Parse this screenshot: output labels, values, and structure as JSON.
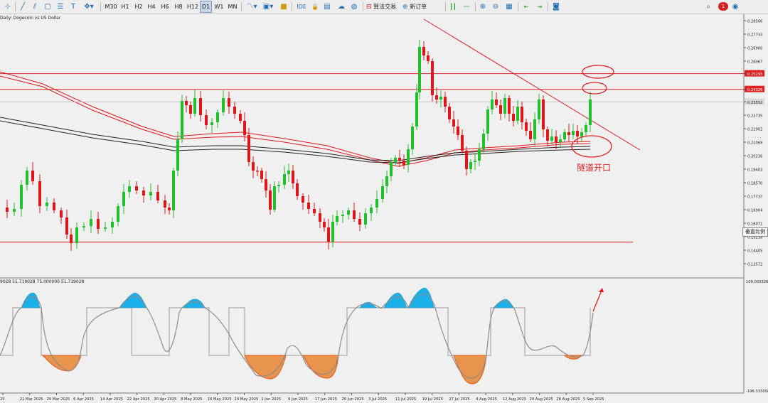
{
  "toolbar": {
    "timeframes": [
      "M30",
      "H1",
      "H2",
      "H4",
      "H6",
      "H8",
      "H12",
      "D1",
      "W1",
      "MN"
    ],
    "active_timeframe": "D1",
    "ide_label": "IDE",
    "algo_label": "算法交易",
    "new_order_label": "新订单",
    "notification_count": "1"
  },
  "chart": {
    "title": "Daily: Dogecoin vs US Dollar",
    "indicator_title": "9028 51.719028 75.000000 51.719028",
    "annotation_text": "隧道开口",
    "scale_label": "垂直比例",
    "price_labels": [
      "0.28566",
      "0.27733",
      "0.26900",
      "0.26067",
      "0.25295",
      "0.24326",
      "0.23552",
      "0.22735",
      "0.21902",
      "0.21069",
      "0.20236",
      "0.19403",
      "0.18570",
      "0.17737",
      "0.16904",
      "0.16071",
      "0.15238",
      "0.14405",
      "0.13572"
    ],
    "highlight_levels": [
      "0.25295",
      "0.24326"
    ],
    "current_price": "0.23552",
    "indicator_scale": [
      "100.003326",
      "-196.333058"
    ],
    "date_labels": [
      "25",
      "21 Mar 2025",
      "29 Mar 2025",
      "6 Apr 2025",
      "14 Apr 2025",
      "22 Apr 2025",
      "30 Apr 2025",
      "8 May 2025",
      "16 May 2025",
      "24 May 2025",
      "1 Jun 2025",
      "9 Jun 2025",
      "17 Jun 2025",
      "25 Jun 2025",
      "3 Jul 2025",
      "11 Jul 2025",
      "19 Jul 2025",
      "27 Jul 2025",
      "4 Aug 2025",
      "12 Aug 2025",
      "20 Aug 2025",
      "28 Aug 2025",
      "5 Sep 2025"
    ],
    "colors": {
      "bull": "#22c02a",
      "bear": "#e0161b",
      "level_line": "#e02020",
      "ma": "#222222",
      "osc_positive": "#1ab0ea",
      "osc_negative": "#e8944e",
      "annotation": "#e02020"
    }
  }
}
